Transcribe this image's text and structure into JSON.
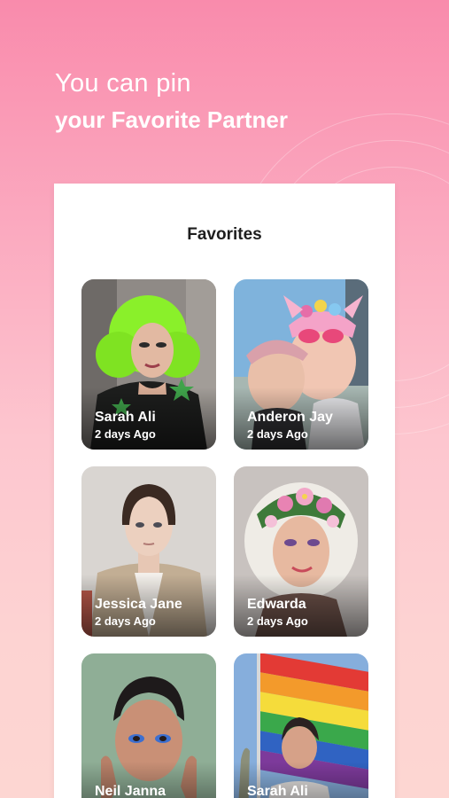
{
  "header": {
    "line1": "You can pin",
    "line2": "your Favorite Partner"
  },
  "panel": {
    "title": "Favorites"
  },
  "favorites": [
    {
      "name": "Sarah Ali",
      "time": "2 days Ago"
    },
    {
      "name": "Anderon Jay",
      "time": "2 days Ago"
    },
    {
      "name": "Jessica Jane",
      "time": "2 days Ago"
    },
    {
      "name": "Edwarda",
      "time": "2 days Ago"
    },
    {
      "name": "Neil Janna",
      "time": ""
    },
    {
      "name": "Sarah Ali",
      "time": ""
    }
  ],
  "colors": {
    "background_top": "#f98bac",
    "background_bottom": "#fdd6d2",
    "panel": "#ffffff",
    "title_text": "#1e1e1e"
  }
}
